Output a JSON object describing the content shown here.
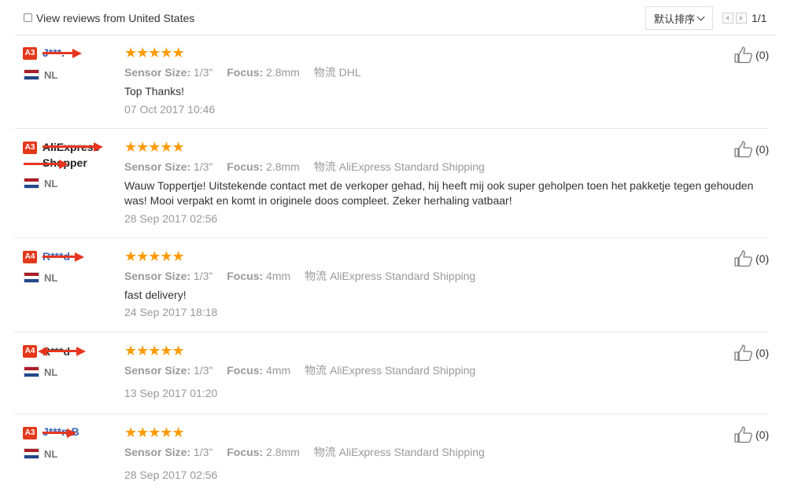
{
  "filter": {
    "us_only_label": "View reviews from United States",
    "us_only_checked": false
  },
  "sort": {
    "label": "默认排序"
  },
  "pagination": {
    "label": "1/1"
  },
  "attr_labels": {
    "sensor": "Sensor Size:",
    "focus": "Focus:",
    "shipping": "物流"
  },
  "reviews": [
    {
      "level": "A3",
      "user": "J***.",
      "country": "NL",
      "stars": "★★★★★",
      "rating": 5,
      "sensor": "1/3\"",
      "focus": "2.8mm",
      "shipping": "DHL",
      "text": "Top Thanks!",
      "date": "07 Oct 2017 10:46",
      "helpful": "(0)"
    },
    {
      "level": "A3",
      "user": "AliExpress Shopper",
      "country": "NL",
      "stars": "★★★★★",
      "rating": 5,
      "sensor": "1/3\"",
      "focus": "2.8mm",
      "shipping": "AliExpress Standard Shipping",
      "text": "Wauw Toppertje! Uitstekende contact met de verkoper gehad, hij heeft mij ook super geholpen toen het pakketje tegen gehouden was! Mooi verpakt en komt in originele doos compleet. Zeker herhaling vatbaar!",
      "date": "28 Sep 2017 02:56",
      "helpful": "(0)"
    },
    {
      "level": "A4",
      "user": "R***d",
      "country": "NL",
      "stars": "★★★★★",
      "rating": 5,
      "sensor": "1/3\"",
      "focus": "4mm",
      "shipping": "AliExpress Standard Shipping",
      "text": "fast delivery!",
      "date": "24 Sep 2017 18:18",
      "helpful": "(0)"
    },
    {
      "level": "A4",
      "user": "R***d",
      "country": "NL",
      "stars": "★★★★★",
      "rating": 5,
      "sensor": "1/3\"",
      "focus": "4mm",
      "shipping": "AliExpress Standard Shipping",
      "text": "",
      "date": "13 Sep 2017 01:20",
      "helpful": "(0)"
    },
    {
      "level": "A3",
      "user": "J***n B",
      "country": "NL",
      "stars": "★★★★★",
      "rating": 5,
      "sensor": "1/3\"",
      "focus": "2.8mm",
      "shipping": "AliExpress Standard Shipping",
      "text": "",
      "date": "28 Sep 2017 02:56",
      "helpful": "(0)"
    }
  ],
  "colors": {
    "star": "#ff9a00",
    "level_badge": "#e4381b",
    "link": "#3c64b4",
    "redaction": "#e8351f",
    "muted": "#999999"
  },
  "icons": {
    "helpful": "thumbs-up-icon",
    "country": "netherlands-flag-icon"
  }
}
